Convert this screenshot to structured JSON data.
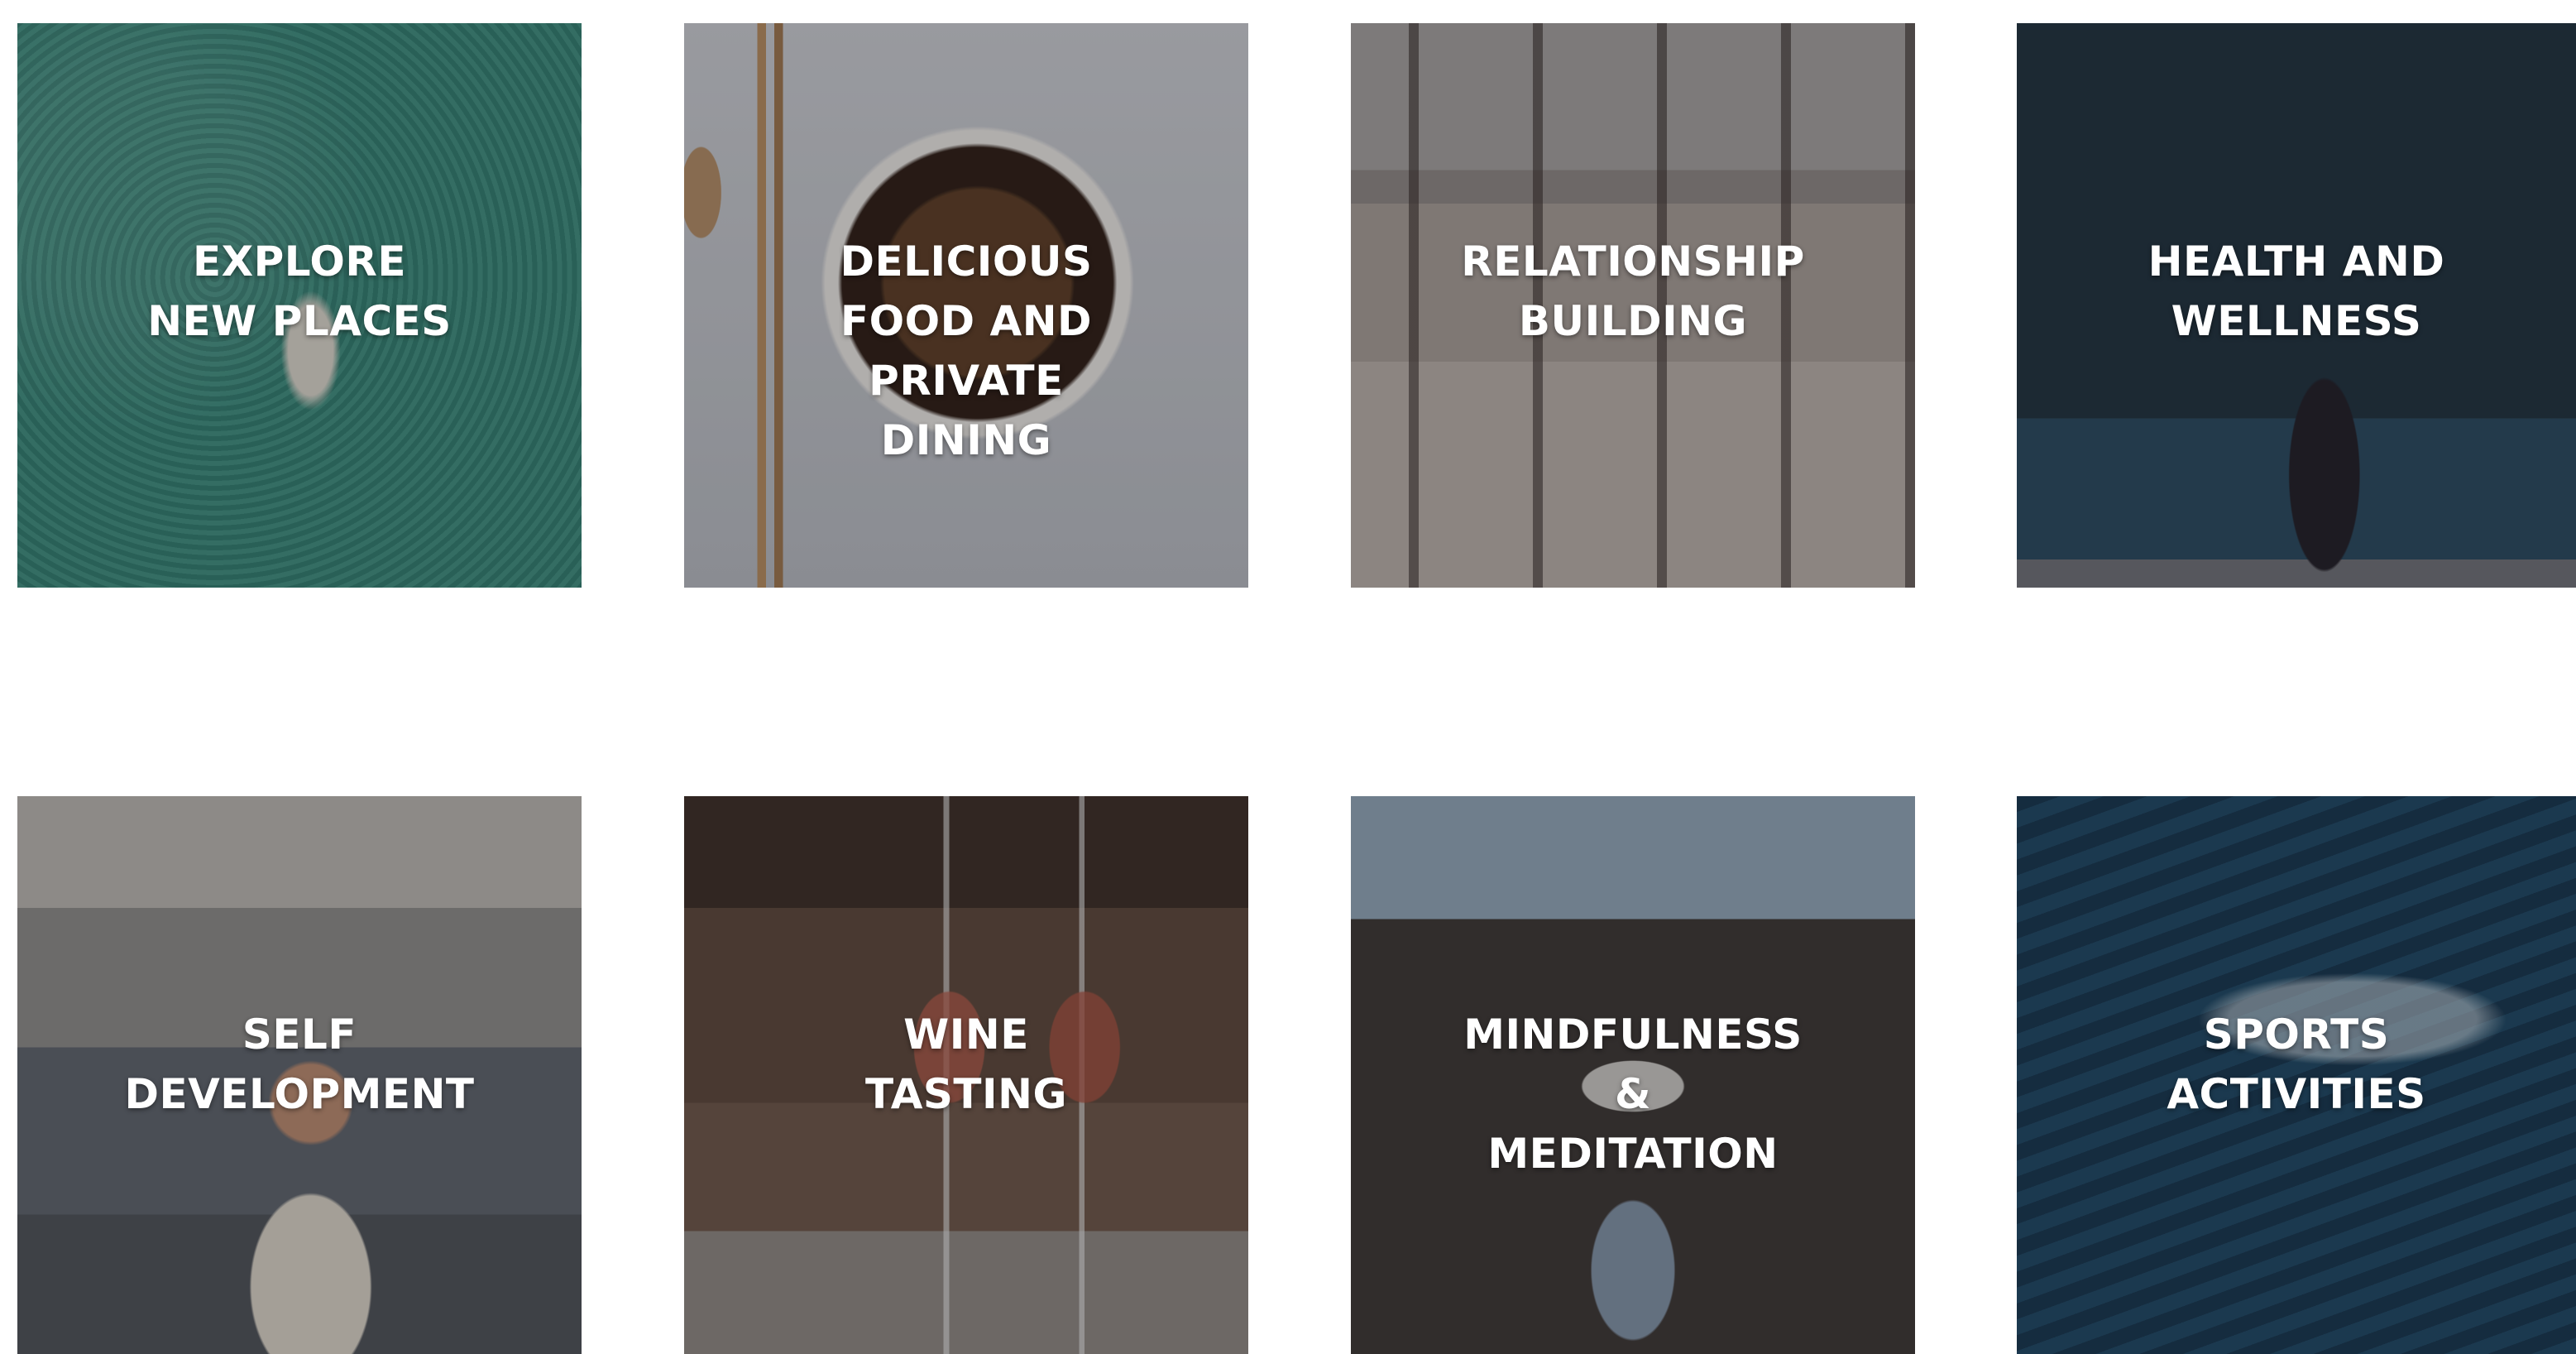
{
  "tiles": [
    {
      "label": "EXPLORE\nNEW PLACES",
      "image": "aerial paddleboard on green sea"
    },
    {
      "label": "DELICIOUS\nFOOD AND\nPRIVATE\nDINING",
      "image": "noodle bowl with chopsticks"
    },
    {
      "label": "RELATIONSHIP\nBUILDING",
      "image": "camel caravan in desert"
    },
    {
      "label": "HEALTH AND\nWELLNESS",
      "image": "yoga pose by the sea"
    },
    {
      "label": "SELF\nDEVELOPMENT",
      "image": "traveler with backpack on street"
    },
    {
      "label": "WINE\nTASTING",
      "image": "wine poured into glasses"
    },
    {
      "label": "MINDFULNESS\n&\nMEDITATION",
      "image": "hiker overlooking canyon"
    },
    {
      "label": "SPORTS\nACTIVITIES",
      "image": "surfer on ocean wave"
    }
  ]
}
